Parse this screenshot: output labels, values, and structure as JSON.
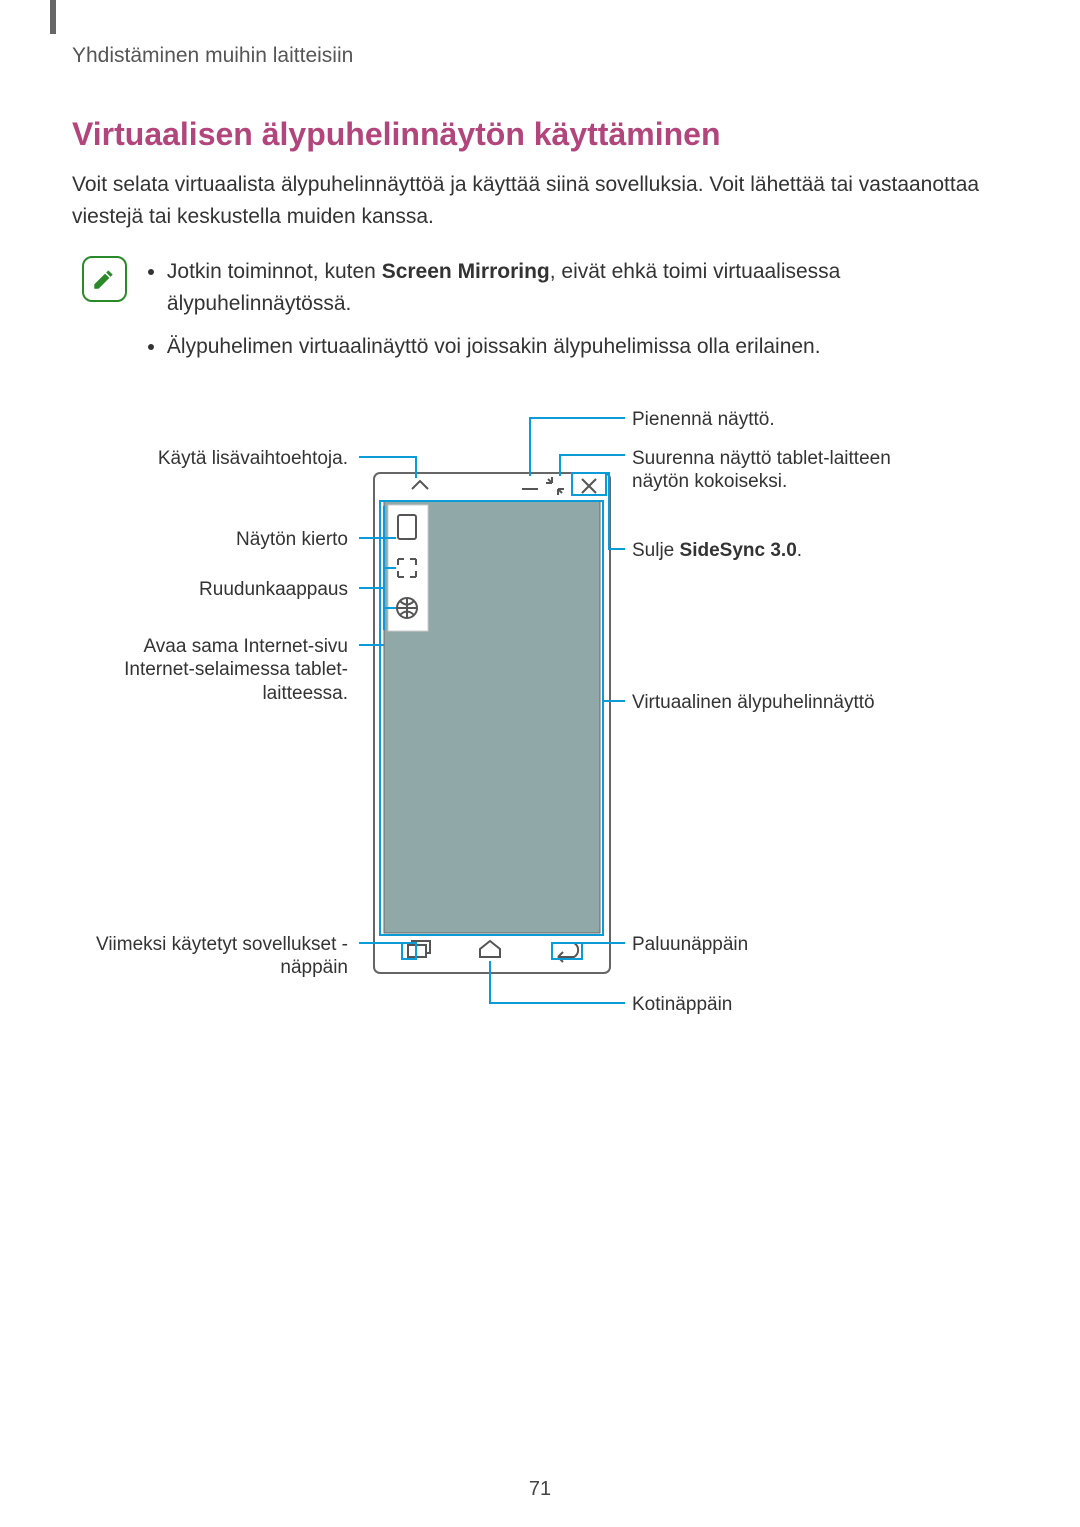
{
  "section_header": "Yhdistäminen muihin laitteisiin",
  "title": "Virtuaalisen älypuhelinnäytön käyttäminen",
  "intro": "Voit selata virtuaalista älypuhelinnäyttöä ja käyttää siinä sovelluksia. Voit lähettää tai vastaanottaa viestejä tai keskustella muiden kanssa.",
  "note_items": {
    "a_before": "Jotkin toiminnot, kuten ",
    "a_bold": "Screen Mirroring",
    "a_after": ", eivät ehkä toimi virtuaalisessa älypuhelinnäytössä.",
    "b": "Älypuhelimen virtuaalinäyttö voi joissakin älypuhelimissa olla erilainen."
  },
  "labels_left": {
    "more_options": "Käytä lisävaihtoehtoja.",
    "rotate": "Näytön kierto",
    "capture": "Ruudunkaappaus",
    "browser": "Avaa sama Internet-sivu Internet-selaimessa tablet-laitteessa.",
    "recent": "Viimeksi käytetyt sovellukset -näppäin"
  },
  "labels_right": {
    "minimize": "Pienennä näyttö.",
    "maximize": "Suurenna näyttö tablet-laitteen näytön kokoiseksi.",
    "close_before": "Sulje ",
    "close_bold": "SideSync 3.0",
    "close_after": ".",
    "virtual": "Virtuaalinen älypuhelinnäyttö",
    "back": "Paluunäppäin",
    "home": "Kotinäppäin"
  },
  "page_number": "71",
  "icons": {
    "note": "note-pen-icon",
    "more": "chevron-up-icon",
    "minimize": "window-minimize-icon",
    "maximize": "window-maximize-icon",
    "close": "close-icon",
    "rotate": "rotate-icon",
    "capture": "fullscreen-icon",
    "browser": "globe-icon",
    "recent": "recent-apps-icon",
    "home": "home-icon",
    "back": "back-icon"
  }
}
